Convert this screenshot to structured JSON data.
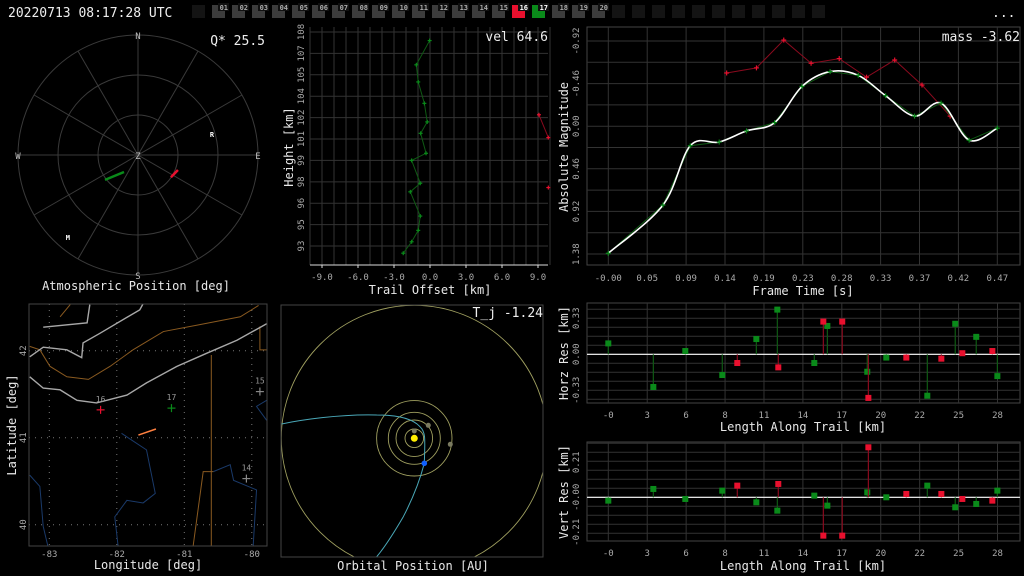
{
  "header": {
    "timestamp": "20220713 08:17:28 UTC",
    "menu_label": "...",
    "frames": [
      {
        "label": "",
        "state": "dark"
      },
      {
        "label": "01",
        "state": "normal"
      },
      {
        "label": "02",
        "state": "normal"
      },
      {
        "label": "03",
        "state": "normal"
      },
      {
        "label": "04",
        "state": "normal"
      },
      {
        "label": "05",
        "state": "normal"
      },
      {
        "label": "06",
        "state": "normal"
      },
      {
        "label": "07",
        "state": "normal"
      },
      {
        "label": "08",
        "state": "normal"
      },
      {
        "label": "09",
        "state": "normal"
      },
      {
        "label": "10",
        "state": "normal"
      },
      {
        "label": "11",
        "state": "normal"
      },
      {
        "label": "12",
        "state": "normal"
      },
      {
        "label": "13",
        "state": "normal"
      },
      {
        "label": "14",
        "state": "normal"
      },
      {
        "label": "15",
        "state": "normal"
      },
      {
        "label": "16",
        "state": "red"
      },
      {
        "label": "17",
        "state": "green"
      },
      {
        "label": "18",
        "state": "normal"
      },
      {
        "label": "19",
        "state": "normal"
      },
      {
        "label": "20",
        "state": "normal"
      },
      {
        "label": "",
        "state": "dark"
      },
      {
        "label": "",
        "state": "dark"
      },
      {
        "label": "",
        "state": "dark"
      },
      {
        "label": "",
        "state": "dark"
      },
      {
        "label": "",
        "state": "dark"
      },
      {
        "label": "",
        "state": "dark"
      },
      {
        "label": "",
        "state": "dark"
      },
      {
        "label": "",
        "state": "dark"
      },
      {
        "label": "",
        "state": "dark"
      },
      {
        "label": "",
        "state": "dark"
      },
      {
        "label": "",
        "state": "dark"
      }
    ]
  },
  "colors": {
    "red": "#e8102e",
    "green": "#0a8a1a",
    "dark_green": "#0f5a14",
    "dark_red": "#8a0a1e",
    "grid": "#333333",
    "frame_normal": "#3c3c3c",
    "frame_dark": "#141414",
    "orbit": "#c8c878",
    "trajectory": "#4aa8b8",
    "sun": "#ffee00",
    "earth": "#1060ff"
  },
  "polar": {
    "title": "Atmospheric Position [deg]",
    "metric": "Q* 25.5",
    "cardinals": {
      "N": "N",
      "E": "E",
      "S": "S",
      "W": "W",
      "Z": "Z"
    },
    "markers": [
      {
        "label": "R",
        "az": 74,
        "zd": 57.7
      },
      {
        "label": "M",
        "az": 220.5,
        "zd": 81
      }
    ],
    "trails": [
      {
        "station": "17",
        "color": "green",
        "from": {
          "az": 233,
          "zd": 31
        },
        "to": {
          "az": 219.5,
          "zd": 16.5
        }
      },
      {
        "station": "16",
        "color": "red",
        "from": {
          "az": 124,
          "zd": 29.8
        },
        "to": {
          "az": 110.6,
          "zd": 32
        }
      }
    ]
  },
  "trail": {
    "title_x": "Trail Offset [km]",
    "title_y": "Height [km]",
    "metric": "vel 64.6",
    "x_ticks": [
      {
        "v": -9,
        "l": "-9.0"
      },
      {
        "v": -6,
        "l": "-6.0"
      },
      {
        "v": -3,
        "l": "-3.0"
      },
      {
        "v": 0,
        "l": "0.0"
      },
      {
        "v": 3,
        "l": "3.0"
      },
      {
        "v": 6,
        "l": "6.0"
      },
      {
        "v": 9,
        "l": "9.0"
      }
    ],
    "y_ticks": [
      {
        "v": 108,
        "l": "108"
      },
      {
        "v": 106.5,
        "l": "107"
      },
      {
        "v": 105,
        "l": "105"
      },
      {
        "v": 103.5,
        "l": "104"
      },
      {
        "v": 102,
        "l": "102"
      },
      {
        "v": 100.5,
        "l": "101"
      },
      {
        "v": 99,
        "l": "99"
      },
      {
        "v": 97.5,
        "l": "98"
      },
      {
        "v": 96,
        "l": "96"
      },
      {
        "v": 94.5,
        "l": "95"
      },
      {
        "v": 93,
        "l": "93"
      }
    ],
    "green": [
      [
        -0.03,
        107.4
      ],
      [
        -1.14,
        105.7
      ],
      [
        -0.98,
        104.5
      ],
      [
        -0.47,
        103.0
      ],
      [
        -0.23,
        101.7
      ],
      [
        -0.78,
        100.9
      ],
      [
        -0.33,
        99.5
      ],
      [
        -1.53,
        99.0
      ],
      [
        -0.81,
        97.4
      ],
      [
        -1.64,
        96.8
      ],
      [
        -0.81,
        95.1
      ],
      [
        -0.98,
        94.1
      ],
      [
        -1.53,
        93.3
      ],
      [
        -2.23,
        92.5
      ]
    ],
    "red": [
      [
        9.08,
        102.2
      ],
      [
        9.86,
        100.6
      ],
      [
        9.86,
        97.1
      ]
    ]
  },
  "magnitude": {
    "title_x": "Frame Time [s]",
    "title_y": "Absolute Magnitude",
    "metric": "mass -3.62",
    "x_ticks": [
      "-0.00",
      "0.05",
      "0.09",
      "0.14",
      "0.19",
      "0.23",
      "0.28",
      "0.33",
      "0.37",
      "0.42",
      "0.47"
    ],
    "y_ticks": [
      {
        "v": -0.92,
        "l": "-0.92"
      },
      {
        "v": -0.46,
        "l": "-0.46"
      },
      {
        "v": 0,
        "l": "0.00"
      },
      {
        "v": 0.46,
        "l": "0.46"
      },
      {
        "v": 0.92,
        "l": "0.92"
      },
      {
        "v": 1.38,
        "l": "1.38"
      }
    ],
    "green": [
      [
        0,
        1.37
      ],
      [
        0.066,
        0.85
      ],
      [
        0.099,
        0.21
      ],
      [
        0.134,
        0.17
      ],
      [
        0.167,
        0.05
      ],
      [
        0.201,
        -0.04
      ],
      [
        0.234,
        -0.43
      ],
      [
        0.268,
        -0.59
      ],
      [
        0.302,
        -0.55
      ],
      [
        0.335,
        -0.33
      ],
      [
        0.37,
        -0.11
      ],
      [
        0.402,
        -0.25
      ],
      [
        0.436,
        0.15
      ],
      [
        0.47,
        0.02
      ]
    ],
    "red": [
      [
        0.143,
        -0.575
      ],
      [
        0.179,
        -0.63
      ],
      [
        0.212,
        -0.93
      ],
      [
        0.245,
        -0.68
      ],
      [
        0.279,
        -0.73
      ],
      [
        0.312,
        -0.53
      ],
      [
        0.346,
        -0.715
      ],
      [
        0.379,
        -0.445
      ],
      [
        0.413,
        -0.11
      ]
    ]
  },
  "residuals": {
    "x_title": "Length Along Trail [km]",
    "x_ticks": [
      "-0",
      "3",
      "6",
      "8",
      "11",
      "14",
      "17",
      "20",
      "22",
      "25",
      "28"
    ],
    "horz": {
      "title_y": "Horz Res [km]",
      "y_ticks": [
        {
          "v": 0.33,
          "l": "0.33"
        },
        {
          "v": 0,
          "l": "0.00"
        },
        {
          "v": -0.33,
          "l": "-0.33"
        }
      ],
      "green": [
        [
          0,
          0.1
        ],
        [
          3.24,
          -0.3
        ],
        [
          5.54,
          0.03
        ],
        [
          8.2,
          -0.19
        ],
        [
          10.65,
          0.14
        ],
        [
          12.16,
          0.41
        ],
        [
          14.82,
          -0.08
        ],
        [
          15.76,
          0.26
        ],
        [
          18.63,
          -0.16
        ],
        [
          20.0,
          -0.03
        ],
        [
          22.95,
          -0.38
        ],
        [
          24.96,
          0.28
        ],
        [
          26.47,
          0.16
        ],
        [
          27.99,
          -0.2
        ]
      ],
      "red": [
        [
          9.28,
          -0.08
        ],
        [
          12.23,
          -0.12
        ],
        [
          15.47,
          0.3
        ],
        [
          16.83,
          0.3
        ],
        [
          18.71,
          -0.4
        ],
        [
          21.44,
          -0.03
        ],
        [
          23.96,
          -0.04
        ],
        [
          25.47,
          0.01
        ],
        [
          27.63,
          0.03
        ]
      ]
    },
    "vert": {
      "title_y": "Vert Res [km]",
      "y_ticks": [
        {
          "v": 0.21,
          "l": "0.21"
        },
        {
          "v": 0,
          "l": "-0.00"
        },
        {
          "v": -0.21,
          "l": "-0.21"
        }
      ],
      "green": [
        [
          0,
          -0.02
        ],
        [
          3.24,
          0.05
        ],
        [
          5.54,
          -0.01
        ],
        [
          8.2,
          0.04
        ],
        [
          10.65,
          -0.03
        ],
        [
          12.16,
          -0.08
        ],
        [
          14.82,
          0.01
        ],
        [
          15.76,
          -0.05
        ],
        [
          18.63,
          0.03
        ],
        [
          20.0,
          0
        ],
        [
          22.95,
          0.07
        ],
        [
          24.96,
          -0.06
        ],
        [
          26.47,
          -0.04
        ],
        [
          27.99,
          0.04
        ]
      ],
      "red": [
        [
          9.28,
          0.07
        ],
        [
          12.23,
          0.08
        ],
        [
          15.47,
          -0.23
        ],
        [
          16.83,
          -0.23
        ],
        [
          18.71,
          0.3
        ],
        [
          21.44,
          0.02
        ],
        [
          23.96,
          0.02
        ],
        [
          25.47,
          -0.01
        ],
        [
          27.63,
          -0.02
        ]
      ]
    }
  },
  "map": {
    "title_x": "Longitude [deg]",
    "title_y": "Latitude [deg]",
    "lon_ticks": [
      {
        "v": -83,
        "l": "-83"
      },
      {
        "v": -82,
        "l": "-82"
      },
      {
        "v": -81,
        "l": "-81"
      },
      {
        "v": -80,
        "l": "-80"
      }
    ],
    "lat_ticks": [
      {
        "v": 42,
        "l": "42"
      },
      {
        "v": 41,
        "l": "41"
      },
      {
        "v": 40,
        "l": "40"
      }
    ],
    "stations": [
      {
        "label": "16",
        "lon": -82.24,
        "lat": 41.32,
        "color": "red"
      },
      {
        "label": "17",
        "lon": -81.19,
        "lat": 41.34,
        "color": "green"
      },
      {
        "label": "15",
        "lon": -79.88,
        "lat": 41.53,
        "color": "grey"
      },
      {
        "label": "14",
        "lon": -80.08,
        "lat": 40.53,
        "color": "grey"
      }
    ],
    "meteor_track": [
      [
        -81.68,
        41.03
      ],
      [
        -81.42,
        41.1
      ]
    ],
    "coast": [
      [
        [
          -83.29,
          41.93
        ],
        [
          -83.09,
          42.04
        ],
        [
          -82.74,
          42.01
        ],
        [
          -82.52,
          41.92
        ],
        [
          -82.5,
          42.09
        ],
        [
          -82.25,
          42.2
        ],
        [
          -81.66,
          42.47
        ],
        [
          -81.61,
          42.54
        ]
      ],
      [
        [
          -83.29,
          41.7
        ],
        [
          -83.09,
          41.57
        ],
        [
          -82.84,
          41.55
        ],
        [
          -82.59,
          41.43
        ],
        [
          -82.3,
          41.4
        ],
        [
          -81.85,
          41.49
        ],
        [
          -81.56,
          41.63
        ],
        [
          -81.11,
          41.82
        ],
        [
          -80.67,
          41.97
        ],
        [
          -80.22,
          42.12
        ],
        [
          -79.78,
          42.31
        ]
      ],
      [
        [
          -83.09,
          42.27
        ],
        [
          -82.44,
          42.32
        ],
        [
          -82.4,
          42.53
        ]
      ]
    ],
    "borders": [
      [
        [
          -83.29,
          42.05
        ],
        [
          -83.14,
          42.01
        ],
        [
          -82.99,
          41.82
        ],
        [
          -82.74,
          41.7
        ],
        [
          -82.42,
          41.67
        ],
        [
          -82.1,
          41.82
        ],
        [
          -81.76,
          42.01
        ],
        [
          -81.31,
          42.22
        ],
        [
          -80.77,
          42.3
        ],
        [
          -80.17,
          42.39
        ],
        [
          -79.9,
          42.52
        ]
      ],
      [
        [
          -80.6,
          41.95
        ],
        [
          -80.6,
          39.75
        ]
      ],
      [
        [
          -80.57,
          40.61
        ],
        [
          -80.72,
          40.61
        ],
        [
          -80.87,
          39.75
        ]
      ],
      [
        [
          -79.88,
          42.28
        ],
        [
          -79.88,
          42.01
        ],
        [
          -79.78,
          42.01
        ]
      ],
      [
        [
          -82.84,
          42.39
        ],
        [
          -82.69,
          42.53
        ]
      ]
    ],
    "rivers": [
      [
        [
          -81.93,
          41.05
        ],
        [
          -81.56,
          40.86
        ],
        [
          -81.43,
          40.36
        ],
        [
          -81.61,
          40.25
        ],
        [
          -81.85,
          40.28
        ],
        [
          -82.03,
          40.09
        ],
        [
          -81.98,
          39.75
        ]
      ],
      [
        [
          -83.29,
          40.57
        ],
        [
          -83.14,
          40.44
        ],
        [
          -83.09,
          39.98
        ],
        [
          -83.02,
          39.75
        ]
      ],
      [
        [
          -80.57,
          40.61
        ],
        [
          -80.32,
          40.69
        ],
        [
          -80.27,
          40.51
        ],
        [
          -79.93,
          40.4
        ],
        [
          -79.98,
          39.75
        ]
      ],
      [
        [
          -79.78,
          41.43
        ],
        [
          -79.93,
          41.36
        ],
        [
          -79.78,
          41.2
        ]
      ]
    ]
  },
  "orbit": {
    "title": "Orbital Position [AU]",
    "metric": "T_j -1.24"
  }
}
